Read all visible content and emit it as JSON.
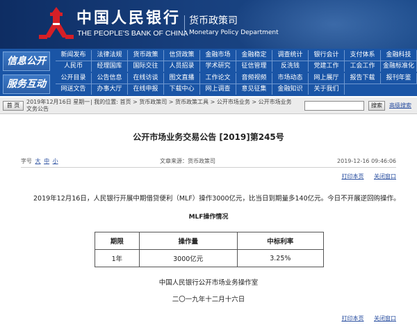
{
  "header": {
    "bank_name_cn": "中国人民银行",
    "bank_name_en": "THE PEOPLE'S BANK OF CHINA",
    "department_cn": "货币政策司",
    "department_en": "Monetary Policy Department"
  },
  "nav": {
    "section1_label": "信息公开",
    "section1_row1": [
      "新闻发布",
      "法律法规",
      "货币政策",
      "信贷政策",
      "金融市场",
      "金融稳定",
      "调查统计",
      "银行会计",
      "支付体系",
      "金融科技"
    ],
    "section1_row2": [
      "人民币",
      "经理国库",
      "国际交往",
      "人员招录",
      "学术研究",
      "征信管理",
      "反洗钱",
      "党建工作",
      "工会工作",
      "金融标准化"
    ],
    "section2_label": "服务互动",
    "section2_row1": [
      "公开目录",
      "公告信息",
      "在线访谈",
      "图文直播",
      "工作论文",
      "音频视频",
      "市场动态",
      "网上展厅",
      "报告下载",
      "报刊年鉴"
    ],
    "section2_row2": [
      "网送文告",
      "办事大厅",
      "在线申报",
      "下载中心",
      "网上调查",
      "意见征集",
      "金融知识",
      "关于我们"
    ]
  },
  "breadcrumb": {
    "home_label": "首 页",
    "date_line1": "2019年12月16日 星期一",
    "date_line2": "文务公告",
    "path": "| 我的位置: 首页  >  货币政策司  >  货币政策工具  >  公开市场业务  >  公开市场业务",
    "search_placeholder": "",
    "search_button": "搜索",
    "advanced_search": "高级搜索"
  },
  "article": {
    "title": "公开市场业务交易公告 [2019]第245号",
    "font_size_label": "字号",
    "font_sizes": [
      "大",
      "中",
      "小"
    ],
    "source": "文章来源：货币政策司",
    "publish_time": "2019-12-16  09:46:06",
    "print_label": "打印本页",
    "close_label": "关闭窗口",
    "body": "2019年12月16日，人民银行开展中期借贷便利（MLF）操作3000亿元，比当日到期量多140亿元。今日不开展逆回购操作。",
    "table_title": "MLF操作情况",
    "table_headers": [
      "期限",
      "操作量",
      "中标利率"
    ],
    "table_rows": [
      [
        "1年",
        "3000亿元",
        "3.25%"
      ]
    ],
    "signature_org": "中国人民银行公开市场业务操作室",
    "signature_date": "二〇一九年十二月十六日"
  }
}
